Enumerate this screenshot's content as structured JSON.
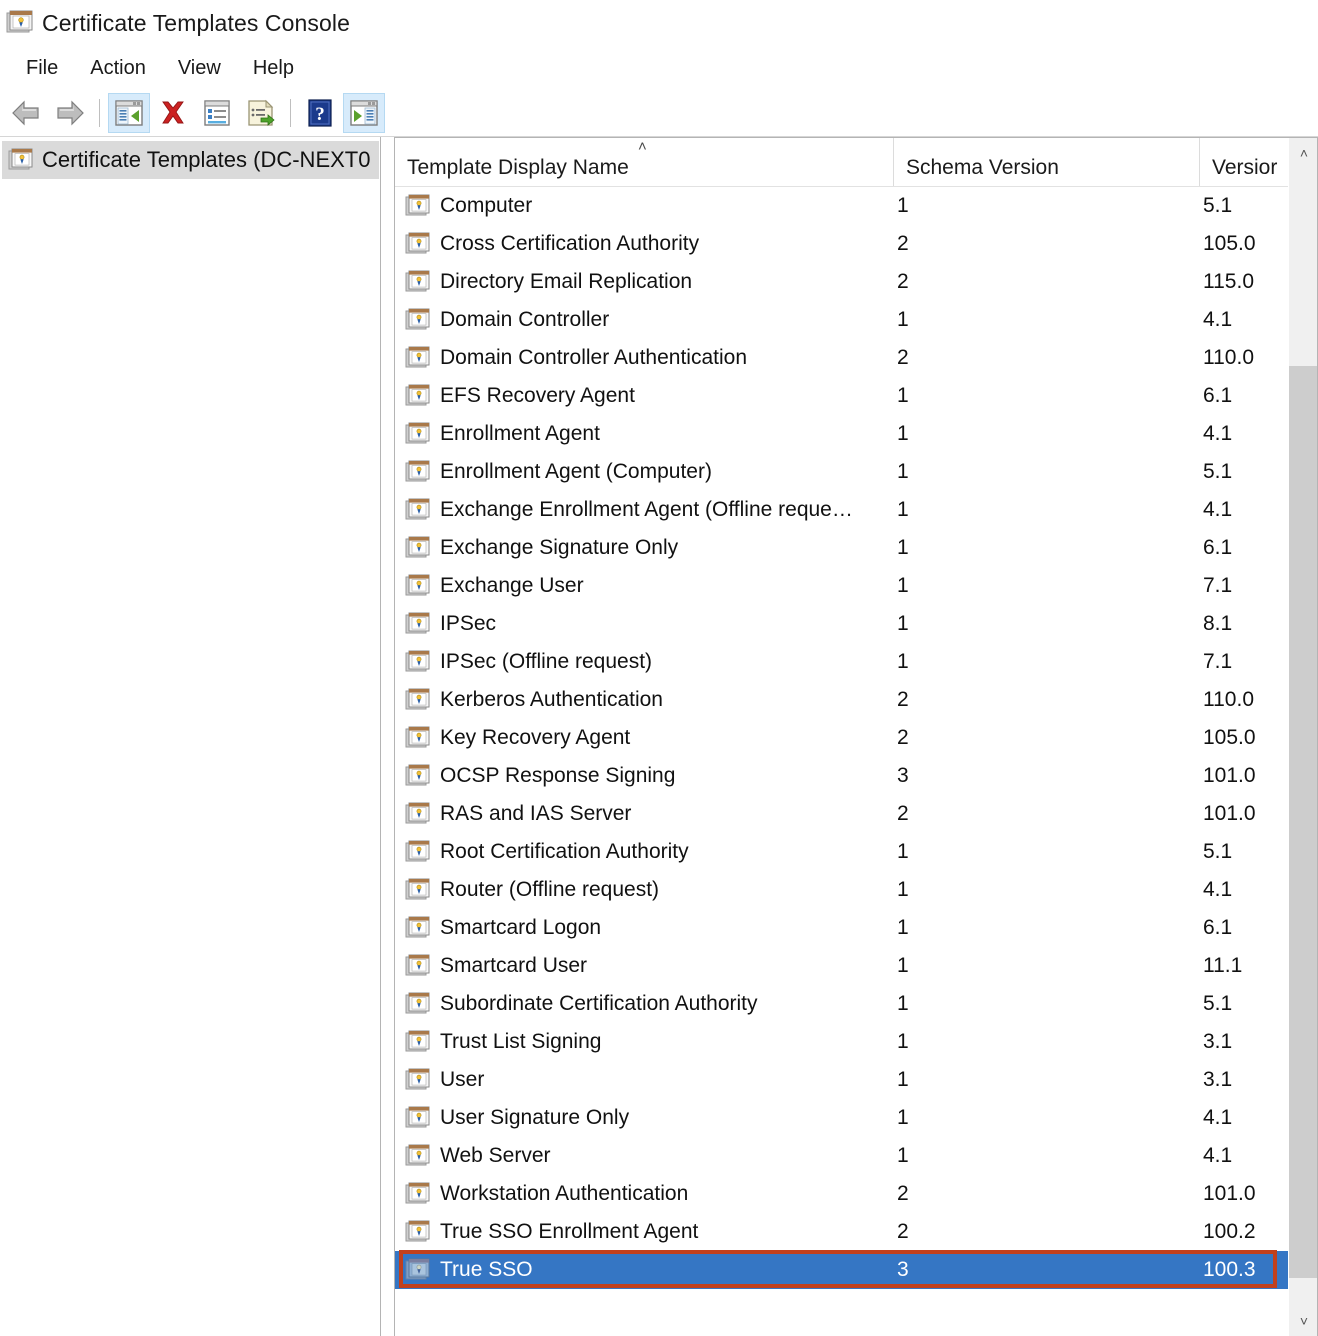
{
  "window": {
    "title": "Certificate Templates Console",
    "title_icon": "certificate-template-icon"
  },
  "menubar": {
    "items": [
      {
        "label": "File",
        "name": "menu-file"
      },
      {
        "label": "Action",
        "name": "menu-action"
      },
      {
        "label": "View",
        "name": "menu-view"
      },
      {
        "label": "Help",
        "name": "menu-help"
      }
    ]
  },
  "toolbar": {
    "buttons": [
      {
        "name": "back-button",
        "icon": "left-arrow-icon",
        "checked": false
      },
      {
        "name": "forward-button",
        "icon": "right-arrow-icon",
        "checked": false
      },
      {
        "name": "show-hide-console-tree-button",
        "icon": "console-tree-icon",
        "checked": true
      },
      {
        "name": "delete-button",
        "icon": "red-x-delete-icon",
        "checked": false
      },
      {
        "name": "properties-button",
        "icon": "properties-window-icon",
        "checked": false
      },
      {
        "name": "export-list-button",
        "icon": "export-list-icon",
        "checked": false
      },
      {
        "name": "help-button",
        "icon": "blue-question-help-icon",
        "checked": false
      },
      {
        "name": "show-hide-action-pane-button",
        "icon": "action-pane-icon",
        "checked": true
      }
    ]
  },
  "tree": {
    "root_label": "Certificate Templates (DC-NEXT0",
    "root_icon": "certificate-template-icon",
    "selected": true
  },
  "list": {
    "columns": [
      {
        "label": "Template Display Name",
        "name": "column-template-display-name",
        "sorted": true,
        "sort_direction": "ascending"
      },
      {
        "label": "Schema Version",
        "name": "column-schema-version",
        "sorted": false
      },
      {
        "label": "Versior",
        "name": "column-version",
        "sorted": false
      }
    ],
    "row_icon": "certificate-template-icon",
    "rows": [
      {
        "name": "Computer",
        "schema": "1",
        "version": "5.1",
        "selected": false
      },
      {
        "name": "Cross Certification Authority",
        "schema": "2",
        "version": "105.0",
        "selected": false
      },
      {
        "name": "Directory Email Replication",
        "schema": "2",
        "version": "115.0",
        "selected": false
      },
      {
        "name": "Domain Controller",
        "schema": "1",
        "version": "4.1",
        "selected": false
      },
      {
        "name": "Domain Controller Authentication",
        "schema": "2",
        "version": "110.0",
        "selected": false
      },
      {
        "name": "EFS Recovery Agent",
        "schema": "1",
        "version": "6.1",
        "selected": false
      },
      {
        "name": "Enrollment Agent",
        "schema": "1",
        "version": "4.1",
        "selected": false
      },
      {
        "name": "Enrollment Agent (Computer)",
        "schema": "1",
        "version": "5.1",
        "selected": false
      },
      {
        "name": "Exchange Enrollment Agent (Offline reque…",
        "schema": "1",
        "version": "4.1",
        "selected": false
      },
      {
        "name": "Exchange Signature Only",
        "schema": "1",
        "version": "6.1",
        "selected": false
      },
      {
        "name": "Exchange User",
        "schema": "1",
        "version": "7.1",
        "selected": false
      },
      {
        "name": "IPSec",
        "schema": "1",
        "version": "8.1",
        "selected": false
      },
      {
        "name": "IPSec (Offline request)",
        "schema": "1",
        "version": "7.1",
        "selected": false
      },
      {
        "name": "Kerberos Authentication",
        "schema": "2",
        "version": "110.0",
        "selected": false
      },
      {
        "name": "Key Recovery Agent",
        "schema": "2",
        "version": "105.0",
        "selected": false
      },
      {
        "name": "OCSP Response Signing",
        "schema": "3",
        "version": "101.0",
        "selected": false
      },
      {
        "name": "RAS and IAS Server",
        "schema": "2",
        "version": "101.0",
        "selected": false
      },
      {
        "name": "Root Certification Authority",
        "schema": "1",
        "version": "5.1",
        "selected": false
      },
      {
        "name": "Router (Offline request)",
        "schema": "1",
        "version": "4.1",
        "selected": false
      },
      {
        "name": "Smartcard Logon",
        "schema": "1",
        "version": "6.1",
        "selected": false
      },
      {
        "name": "Smartcard User",
        "schema": "1",
        "version": "11.1",
        "selected": false
      },
      {
        "name": "Subordinate Certification Authority",
        "schema": "1",
        "version": "5.1",
        "selected": false
      },
      {
        "name": "Trust List Signing",
        "schema": "1",
        "version": "3.1",
        "selected": false
      },
      {
        "name": "User",
        "schema": "1",
        "version": "3.1",
        "selected": false
      },
      {
        "name": "User Signature Only",
        "schema": "1",
        "version": "4.1",
        "selected": false
      },
      {
        "name": "Web Server",
        "schema": "1",
        "version": "4.1",
        "selected": false
      },
      {
        "name": "Workstation Authentication",
        "schema": "2",
        "version": "101.0",
        "selected": false
      },
      {
        "name": "True SSO Enrollment Agent",
        "schema": "2",
        "version": "100.2",
        "selected": false
      },
      {
        "name": "True SSO",
        "schema": "3",
        "version": "100.3",
        "selected": true
      }
    ]
  },
  "scrollbar": {
    "up_arrow": "˄",
    "down_arrow": "˅"
  },
  "colors": {
    "selection_blue": "#3576c4",
    "annotation_red": "#c1401d",
    "toolbar_checked": "#d7ebfb",
    "tree_selection_gray": "#dadada"
  }
}
